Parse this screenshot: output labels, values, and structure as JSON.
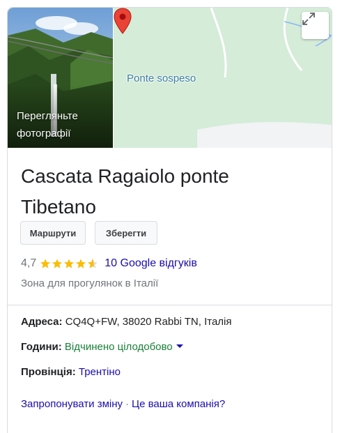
{
  "photos": {
    "caption_line1": "Перегляньте",
    "caption_line2": "фотографії"
  },
  "map": {
    "place_label": "Ponte sospeso",
    "pin_icon": "map-pin-icon",
    "expand_icon": "expand-icon"
  },
  "place": {
    "title_line1": "Cascata Ragaiolo ponte",
    "title_line2": "Tibetano"
  },
  "actions": {
    "routes_label": "Маршрути",
    "save_label": "Зберегти"
  },
  "rating": {
    "value": "4,7",
    "stars": 4.7,
    "reviews_label": "10 Google відгуків"
  },
  "category": "Зона для прогулянок в Італії",
  "details": {
    "address_label": "Адреса:",
    "address_value": "CQ4Q+FW, 38020 Rabbi TN, Італія",
    "hours_label": "Години:",
    "hours_value": "Відчинено цілодобово",
    "province_label": "Провінція:",
    "province_value": "Трентіно"
  },
  "footer": {
    "suggest_edit": "Запропонувати зміну",
    "separator": "·",
    "own_business": "Це ваша компанія?"
  },
  "colors": {
    "link": "#1a0dab",
    "open": "#188038",
    "star": "#fbbc04",
    "pin": "#ea4335",
    "map_bg": "#d4ecd8"
  }
}
